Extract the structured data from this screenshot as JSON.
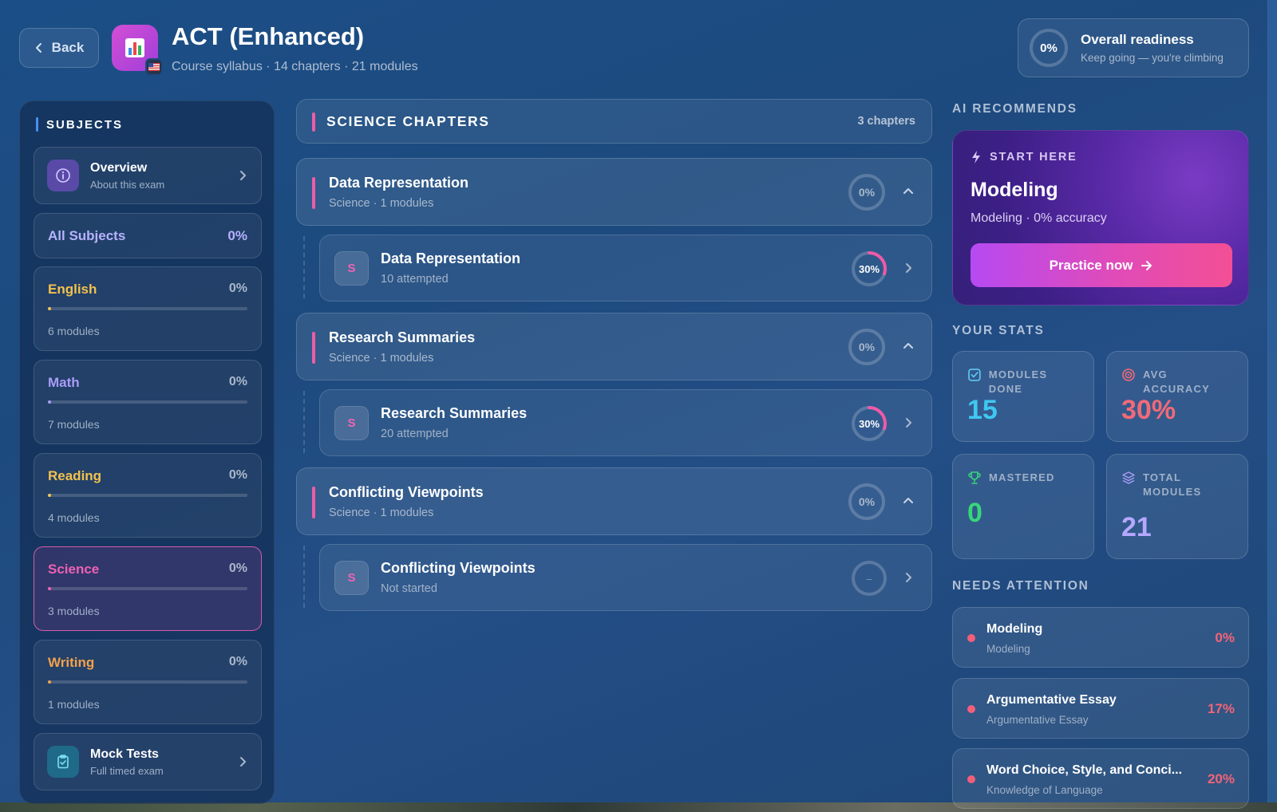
{
  "header": {
    "back_label": "Back",
    "title": "ACT (Enhanced)",
    "subtitle": "Course syllabus · 14 chapters · 21 modules",
    "readiness": {
      "value": "0%",
      "title": "Overall readiness",
      "subtitle": "Keep going — you're climbing"
    }
  },
  "sidebar": {
    "heading": "SUBJECTS",
    "overview": {
      "title": "Overview",
      "subtitle": "About this exam"
    },
    "all_subjects": {
      "label": "All Subjects",
      "percent": "0%"
    },
    "subjects": [
      {
        "name": "English",
        "percent": "0%",
        "modules": "6 modules",
        "color": "#f2c14e"
      },
      {
        "name": "Math",
        "percent": "0%",
        "modules": "7 modules",
        "color": "#a99cf7"
      },
      {
        "name": "Reading",
        "percent": "0%",
        "modules": "4 modules",
        "color": "#f2c14e"
      },
      {
        "name": "Science",
        "percent": "0%",
        "modules": "3 modules",
        "color": "#ee61b4"
      },
      {
        "name": "Writing",
        "percent": "0%",
        "modules": "1 modules",
        "color": "#f4a14a"
      }
    ],
    "mock_tests": {
      "title": "Mock Tests",
      "subtitle": "Full timed exam"
    }
  },
  "main": {
    "section_title": "SCIENCE CHAPTERS",
    "section_count": "3 chapters",
    "chapters": [
      {
        "name": "Data Representation",
        "meta": "Science · 1 modules",
        "percent": "0%",
        "module": {
          "badge": "S",
          "name": "Data Representation",
          "meta": "10 attempted",
          "percent": "30%",
          "progress": 0.3
        }
      },
      {
        "name": "Research Summaries",
        "meta": "Science · 1 modules",
        "percent": "0%",
        "module": {
          "badge": "S",
          "name": "Research Summaries",
          "meta": "20 attempted",
          "percent": "30%",
          "progress": 0.3
        }
      },
      {
        "name": "Conflicting Viewpoints",
        "meta": "Science · 1 modules",
        "percent": "0%",
        "module": {
          "badge": "S",
          "name": "Conflicting Viewpoints",
          "meta": "Not started",
          "percent": "–",
          "progress": 0
        }
      }
    ]
  },
  "right": {
    "ai_label": "AI RECOMMENDS",
    "recommend": {
      "tag": "START HERE",
      "title": "Modeling",
      "subtitle": "Modeling · 0% accuracy",
      "button": "Practice now"
    },
    "stats_label": "YOUR STATS",
    "stats": {
      "modules_done": {
        "label": "MODULES DONE",
        "value": "15"
      },
      "avg_accuracy": {
        "label": "AVG ACCURACY",
        "value": "30%"
      },
      "mastered": {
        "label": "MASTERED",
        "value": "0"
      },
      "total_modules": {
        "label": "TOTAL MODULES",
        "value": "21"
      }
    },
    "attention_label": "NEEDS ATTENTION",
    "attention": [
      {
        "name": "Modeling",
        "sub": "Modeling",
        "percent": "0%"
      },
      {
        "name": "Argumentative Essay",
        "sub": "Argumentative Essay",
        "percent": "17%"
      },
      {
        "name": "Word Choice, Style, and Conci...",
        "sub": "Knowledge of Language",
        "percent": "20%"
      }
    ]
  },
  "colors": {
    "accent_pink": "#ec5da6",
    "accent_purple": "#a99cf7",
    "stat_blue": "#3fc8f0",
    "stat_red": "#f26a78",
    "stat_green": "#37d67a"
  }
}
